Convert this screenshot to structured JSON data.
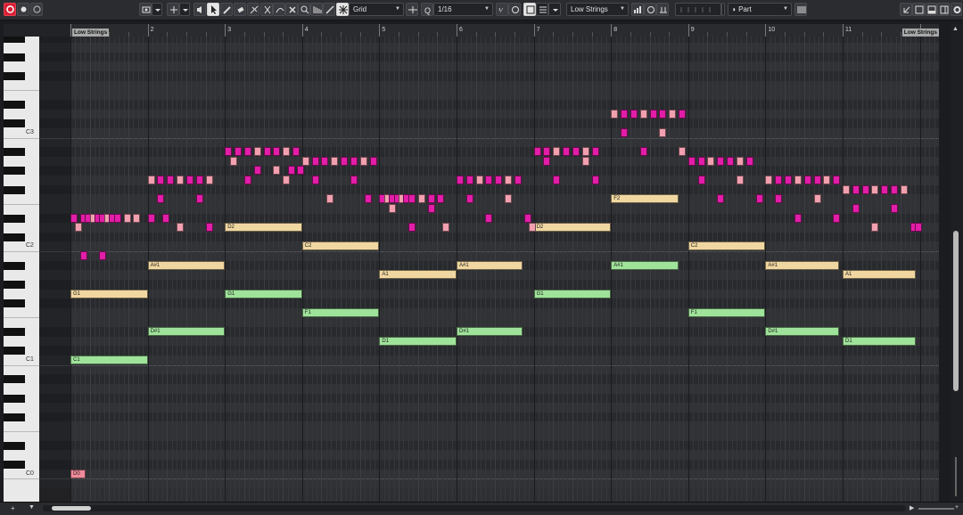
{
  "toolbar": {
    "record_icon": "record-icon",
    "edit_mode_icon": "edit-mode-icon",
    "grid_type": "Grid",
    "quantize_value": "1/16",
    "track_select": "Low Strings",
    "part_select": "Part"
  },
  "ruler": {
    "bars": [
      "2",
      "3",
      "4",
      "5",
      "6",
      "7",
      "8",
      "9",
      "10",
      "11"
    ],
    "locator_left": "Low Strings",
    "locator_right": "Low Strings"
  },
  "keyboard": {
    "labels": [
      "C3",
      "C2",
      "C1",
      "C0"
    ]
  },
  "notes": [
    {
      "label": "C1",
      "color": "#9fe39a"
    },
    {
      "label": "G1",
      "color": "#f0d7a1"
    },
    {
      "label": "D#1",
      "color": "#9fe39a"
    },
    {
      "label": "A#1",
      "color": "#f0d7a1"
    },
    {
      "label": "D2",
      "color": "#f0d7a1"
    },
    {
      "label": "G1",
      "color": "#9fe39a"
    },
    {
      "label": "F1",
      "color": "#9fe39a"
    },
    {
      "label": "C2",
      "color": "#f0d7a1"
    },
    {
      "label": "D1",
      "color": "#9fe39a"
    },
    {
      "label": "A1",
      "color": "#f0d7a1"
    },
    {
      "label": "D#1",
      "color": "#9fe39a"
    },
    {
      "label": "A#1",
      "color": "#f0d7a1"
    },
    {
      "label": "D2",
      "color": "#f0d7a1"
    },
    {
      "label": "G1",
      "color": "#9fe39a"
    },
    {
      "label": "F2",
      "color": "#f0d7a1"
    },
    {
      "label": "A#1",
      "color": "#9fe39a"
    },
    {
      "label": "C2",
      "color": "#f0d7a1"
    },
    {
      "label": "F1",
      "color": "#9fe39a"
    },
    {
      "label": "A#1",
      "color": "#f0d7a1"
    },
    {
      "label": "D#1",
      "color": "#9fe39a"
    },
    {
      "label": "A1",
      "color": "#f0d7a1"
    },
    {
      "label": "D1",
      "color": "#9fe39a"
    },
    {
      "label": "D0",
      "color": "#f08a9a"
    }
  ],
  "bottom": {
    "add_icon": "plus-icon",
    "menu_icon": "chevron-down-icon"
  }
}
